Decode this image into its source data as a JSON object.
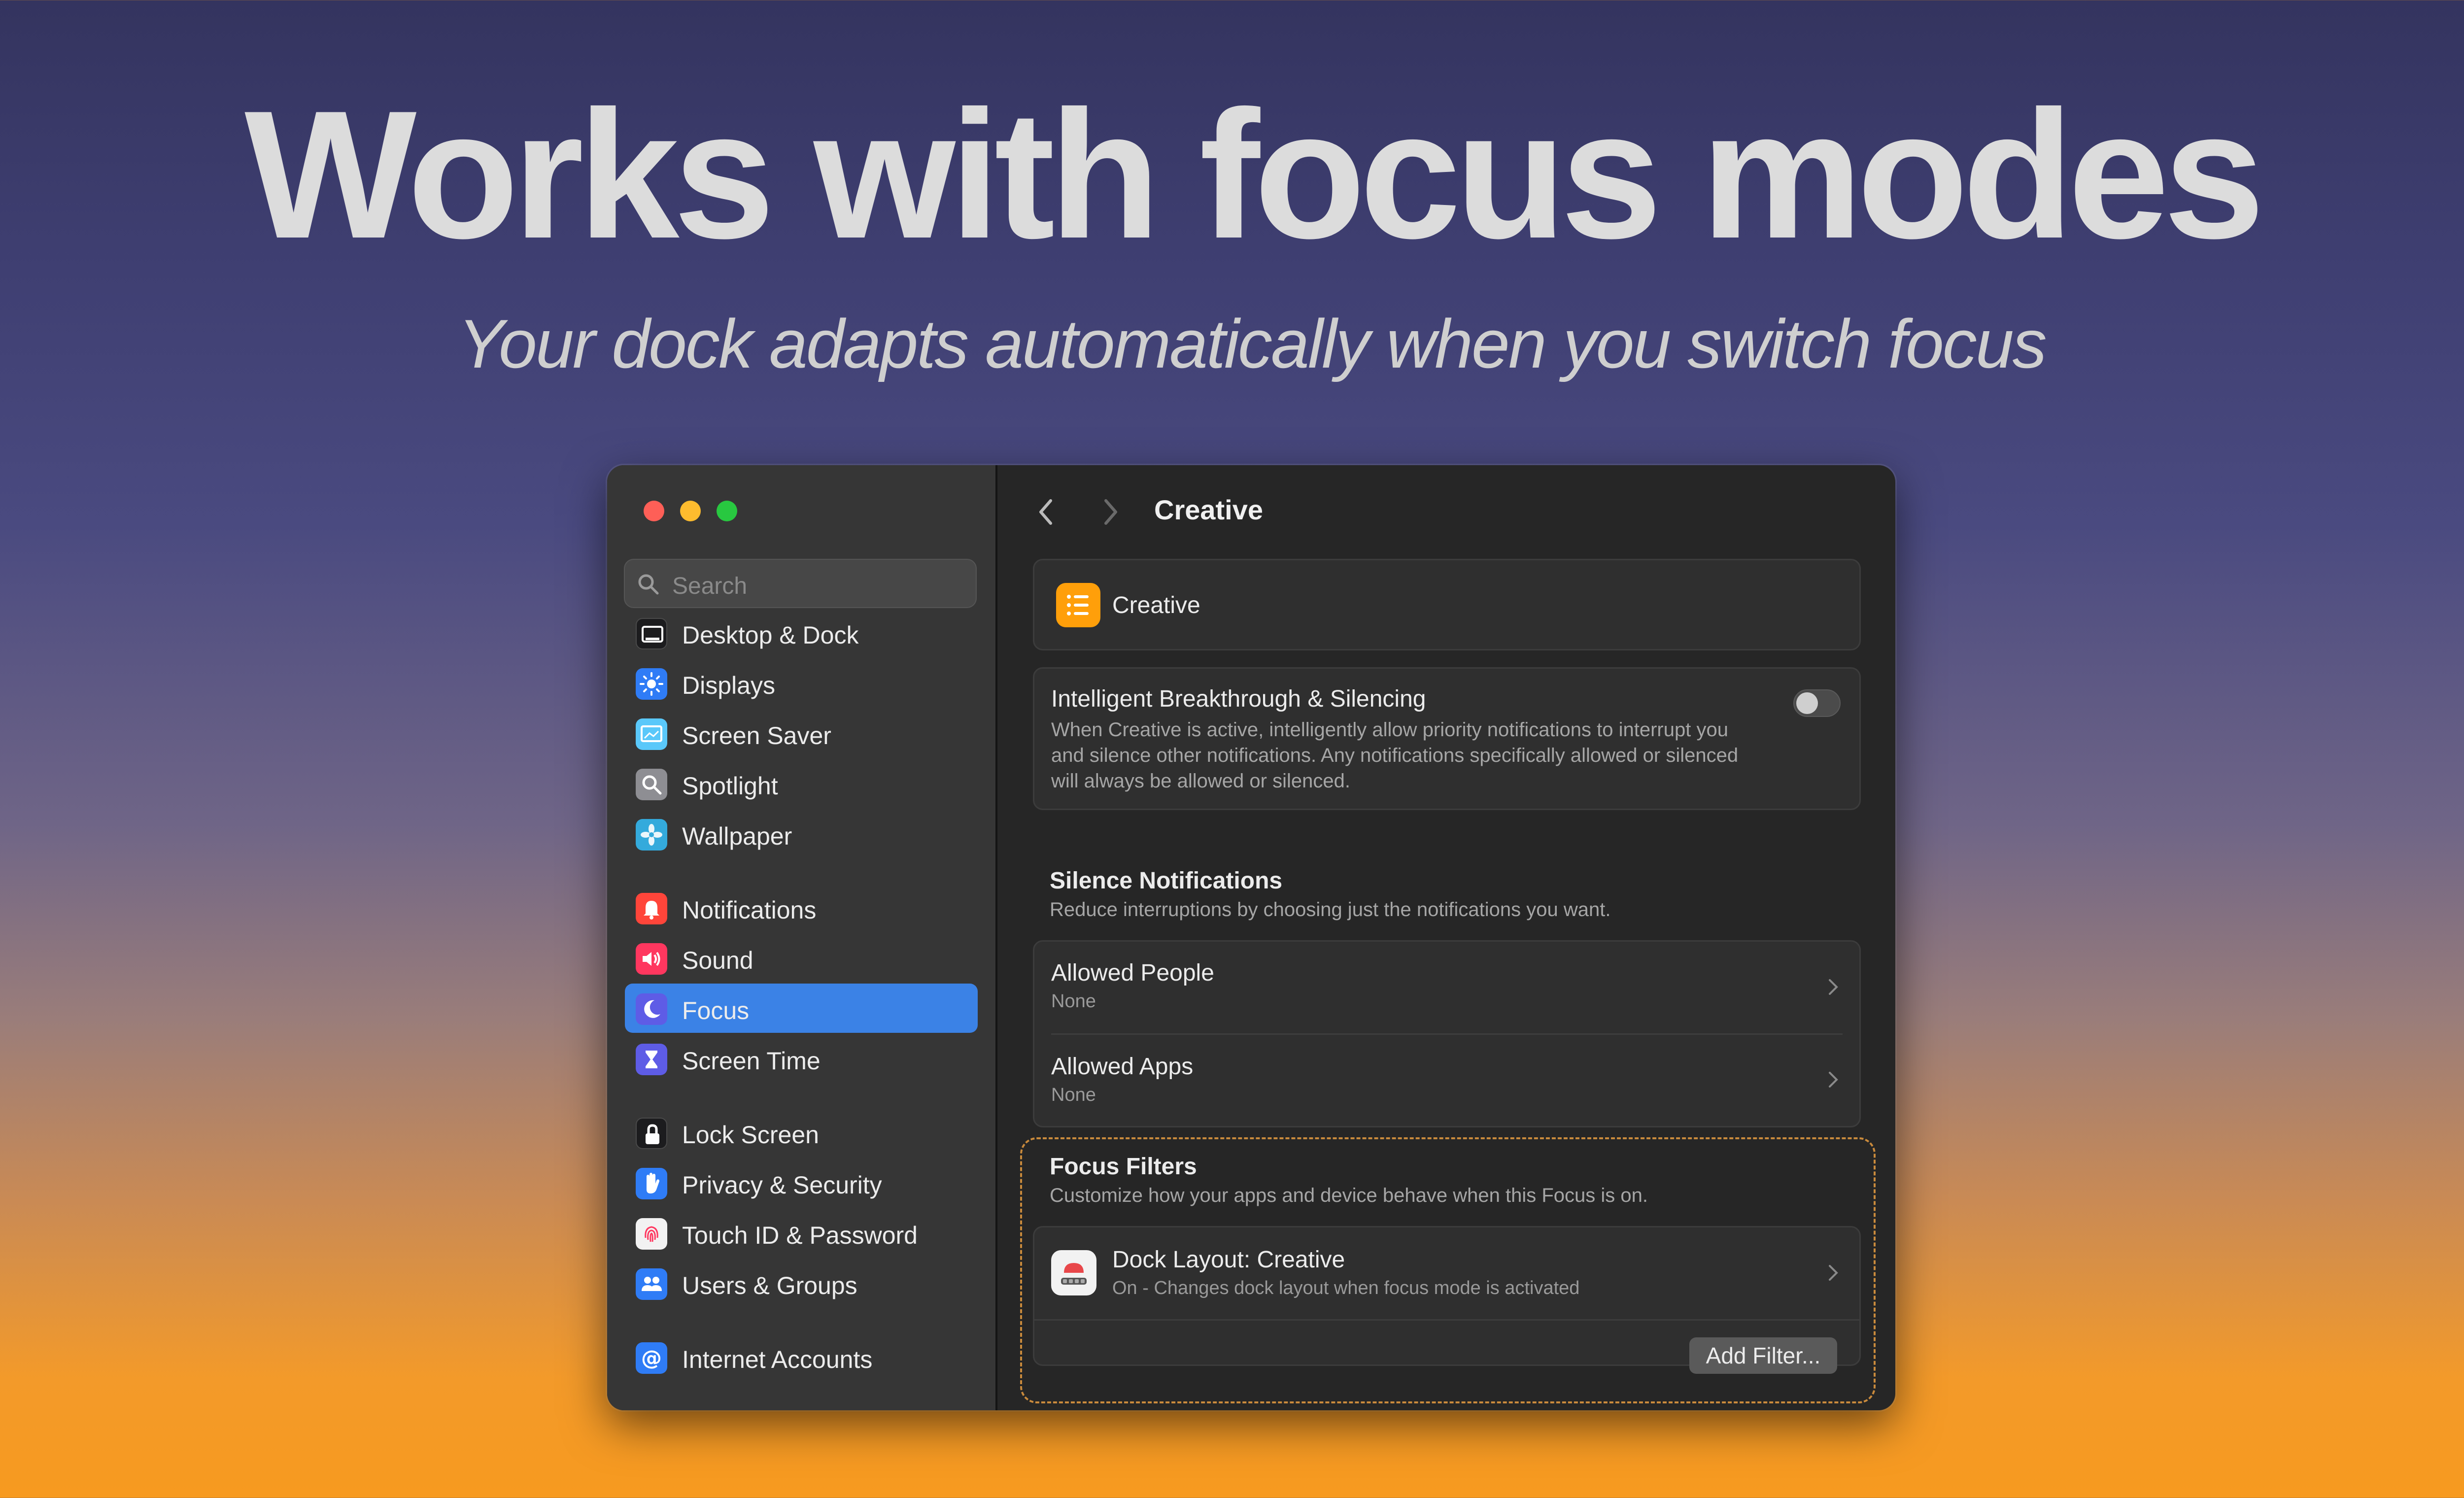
{
  "hero": {
    "title": "Works with focus modes",
    "subtitle": "Your dock adapts automatically when you switch focus"
  },
  "window": {
    "search": {
      "placeholder": "Search"
    },
    "sidebar": {
      "items": [
        {
          "label": "Desktop & Dock",
          "icon": "desktop-dock-icon",
          "color": "#1c1c1e"
        },
        {
          "label": "Displays",
          "icon": "displays-icon",
          "color": "#2f7cf6"
        },
        {
          "label": "Screen Saver",
          "icon": "screen-saver-icon",
          "color": "#5ac8fa"
        },
        {
          "label": "Spotlight",
          "icon": "spotlight-icon",
          "color": "#8e8e93"
        },
        {
          "label": "Wallpaper",
          "icon": "wallpaper-icon",
          "color": "#34aadc"
        },
        {
          "label": "Notifications",
          "icon": "bell-icon",
          "color": "#ff453a"
        },
        {
          "label": "Sound",
          "icon": "speaker-icon",
          "color": "#ff375f"
        },
        {
          "label": "Focus",
          "icon": "moon-icon",
          "color": "#5e5ce6",
          "selected": true
        },
        {
          "label": "Screen Time",
          "icon": "hourglass-icon",
          "color": "#5e5ce6"
        },
        {
          "label": "Lock Screen",
          "icon": "lock-icon",
          "color": "#1c1c1e"
        },
        {
          "label": "Privacy & Security",
          "icon": "hand-icon",
          "color": "#2f7cf6"
        },
        {
          "label": "Touch ID & Password",
          "icon": "fingerprint-icon",
          "color": "#f2f2f2"
        },
        {
          "label": "Users & Groups",
          "icon": "users-icon",
          "color": "#2f7cf6"
        },
        {
          "label": "Internet Accounts",
          "icon": "at-icon",
          "color": "#2f7cf6"
        }
      ]
    },
    "header": {
      "title": "Creative"
    },
    "focus_name": {
      "label": "Creative",
      "icon": "list-icon",
      "color": "#ff9f0a"
    },
    "breakthrough": {
      "title": "Intelligent Breakthrough & Silencing",
      "description": "When Creative is active, intelligently allow priority notifications to interrupt you and silence other notifications. Any notifications specifically allowed or silenced will always be allowed or silenced.",
      "enabled": false
    },
    "silence": {
      "title": "Silence Notifications",
      "subtitle": "Reduce interruptions by choosing just the notifications you want.",
      "rows": [
        {
          "title": "Allowed People",
          "value": "None"
        },
        {
          "title": "Allowed Apps",
          "value": "None"
        }
      ]
    },
    "filters": {
      "title": "Focus Filters",
      "subtitle": "Customize how your apps and device behave when this Focus is on.",
      "item": {
        "title": "Dock Layout: Creative",
        "subtitle": "On - Changes dock layout when focus mode is activated"
      },
      "add_button": "Add Filter..."
    }
  },
  "colors": {
    "accent": "#3b82e6",
    "highlight": "#c98a3c"
  }
}
